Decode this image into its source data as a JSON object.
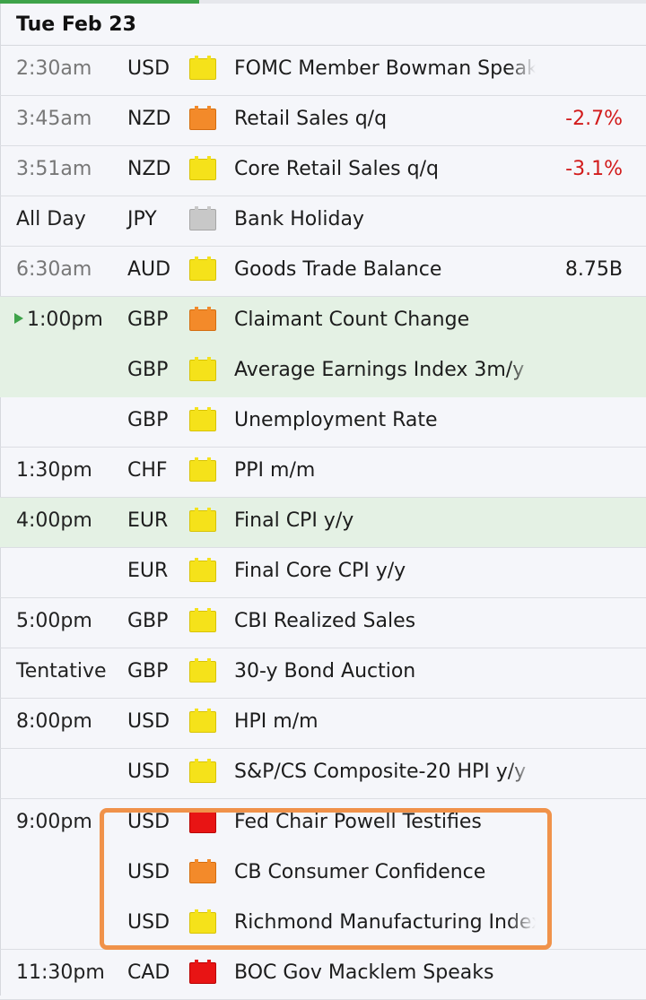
{
  "date_header": "Tue Feb 23",
  "colors": {
    "accent": "#3ea34a",
    "negative": "#d21b1b",
    "highlight": "#f0924a",
    "row_highlight": "#e4f1e4"
  },
  "rows": [
    {
      "time": "2:30am",
      "currency": "USD",
      "impact": "low",
      "event": "FOMC Member Bowman Speaks",
      "value": ""
    },
    {
      "time": "3:45am",
      "currency": "NZD",
      "impact": "medium",
      "event": "Retail Sales q/q",
      "value": "-2.7%"
    },
    {
      "time": "3:51am",
      "currency": "NZD",
      "impact": "low",
      "event": "Core Retail Sales q/q",
      "value": "-3.1%"
    },
    {
      "time": "All Day",
      "currency": "JPY",
      "impact": "non-economic",
      "event": "Bank Holiday",
      "value": ""
    },
    {
      "time": "6:30am",
      "currency": "AUD",
      "impact": "low",
      "event": "Goods Trade Balance",
      "value": "8.75B"
    },
    {
      "time": "1:00pm",
      "currency": "GBP",
      "impact": "medium",
      "event": "Claimant Count Change",
      "value": ""
    },
    {
      "time": "",
      "currency": "GBP",
      "impact": "low",
      "event": "Average Earnings Index 3m/y",
      "value": ""
    },
    {
      "time": "",
      "currency": "GBP",
      "impact": "low",
      "event": "Unemployment Rate",
      "value": ""
    },
    {
      "time": "1:30pm",
      "currency": "CHF",
      "impact": "low",
      "event": "PPI m/m",
      "value": ""
    },
    {
      "time": "4:00pm",
      "currency": "EUR",
      "impact": "low",
      "event": "Final CPI y/y",
      "value": ""
    },
    {
      "time": "",
      "currency": "EUR",
      "impact": "low",
      "event": "Final Core CPI y/y",
      "value": ""
    },
    {
      "time": "5:00pm",
      "currency": "GBP",
      "impact": "low",
      "event": "CBI Realized Sales",
      "value": ""
    },
    {
      "time": "Tentative",
      "currency": "GBP",
      "impact": "low",
      "event": "30-y Bond Auction",
      "value": ""
    },
    {
      "time": "8:00pm",
      "currency": "USD",
      "impact": "low",
      "event": "HPI m/m",
      "value": ""
    },
    {
      "time": "",
      "currency": "USD",
      "impact": "low",
      "event": "S&P/CS Composite-20 HPI y/y",
      "value": ""
    },
    {
      "time": "9:00pm",
      "currency": "USD",
      "impact": "high",
      "event": "Fed Chair Powell Testifies",
      "value": ""
    },
    {
      "time": "",
      "currency": "USD",
      "impact": "medium",
      "event": "CB Consumer Confidence",
      "value": ""
    },
    {
      "time": "",
      "currency": "USD",
      "impact": "low",
      "event": "Richmond Manufacturing Index",
      "value": ""
    },
    {
      "time": "11:30pm",
      "currency": "CAD",
      "impact": "high",
      "event": "BOC Gov Macklem Speaks",
      "value": ""
    }
  ]
}
